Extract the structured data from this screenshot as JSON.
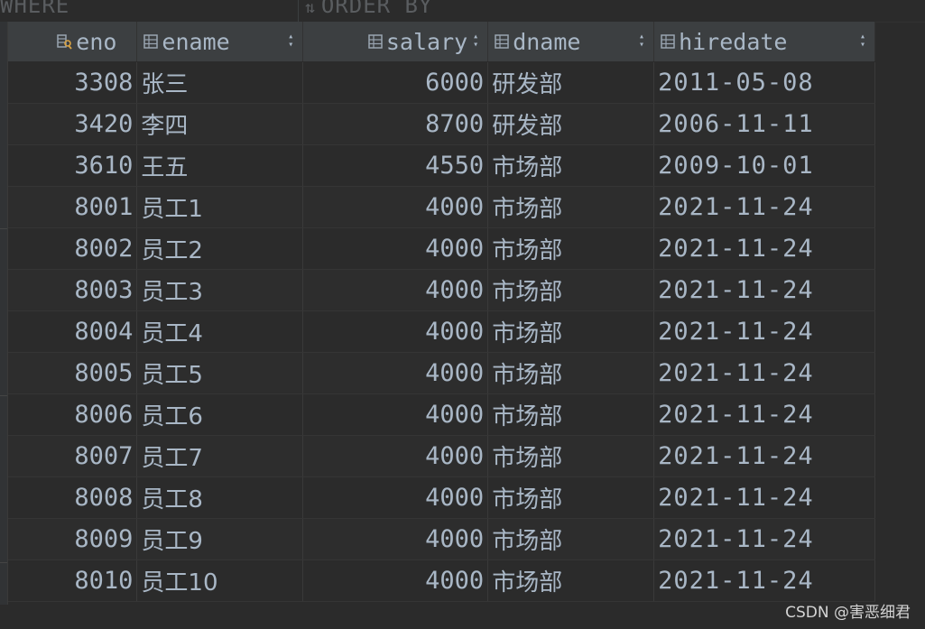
{
  "filters": {
    "where_label": "WHERE",
    "order_label": "ORDER BY",
    "order_icon": "sort-icon"
  },
  "columns": [
    {
      "name": "eno",
      "icon": "primary-key-column-icon"
    },
    {
      "name": "ename",
      "icon": "column-icon"
    },
    {
      "name": "salary",
      "icon": "column-icon"
    },
    {
      "name": "dname",
      "icon": "column-icon"
    },
    {
      "name": "hiredate",
      "icon": "column-icon"
    }
  ],
  "rows": [
    [
      "3308",
      "张三",
      "6000",
      "研发部",
      "2011-05-08"
    ],
    [
      "3420",
      "李四",
      "8700",
      "研发部",
      "2006-11-11"
    ],
    [
      "3610",
      "王五",
      "4550",
      "市场部",
      "2009-10-01"
    ],
    [
      "8001",
      "员工1",
      "4000",
      "市场部",
      "2021-11-24"
    ],
    [
      "8002",
      "员工2",
      "4000",
      "市场部",
      "2021-11-24"
    ],
    [
      "8003",
      "员工3",
      "4000",
      "市场部",
      "2021-11-24"
    ],
    [
      "8004",
      "员工4",
      "4000",
      "市场部",
      "2021-11-24"
    ],
    [
      "8005",
      "员工5",
      "4000",
      "市场部",
      "2021-11-24"
    ],
    [
      "8006",
      "员工6",
      "4000",
      "市场部",
      "2021-11-24"
    ],
    [
      "8007",
      "员工7",
      "4000",
      "市场部",
      "2021-11-24"
    ],
    [
      "8008",
      "员工8",
      "4000",
      "市场部",
      "2021-11-24"
    ],
    [
      "8009",
      "员工9",
      "4000",
      "市场部",
      "2021-11-24"
    ],
    [
      "8010",
      "员工10",
      "4000",
      "市场部",
      "2021-11-24"
    ]
  ],
  "watermark": "CSDN @害恶细君",
  "colors": {
    "background": "#2b2b2b",
    "header": "#3c3f41",
    "text": "#a9b7c6",
    "key_icon": "#d9a343"
  }
}
